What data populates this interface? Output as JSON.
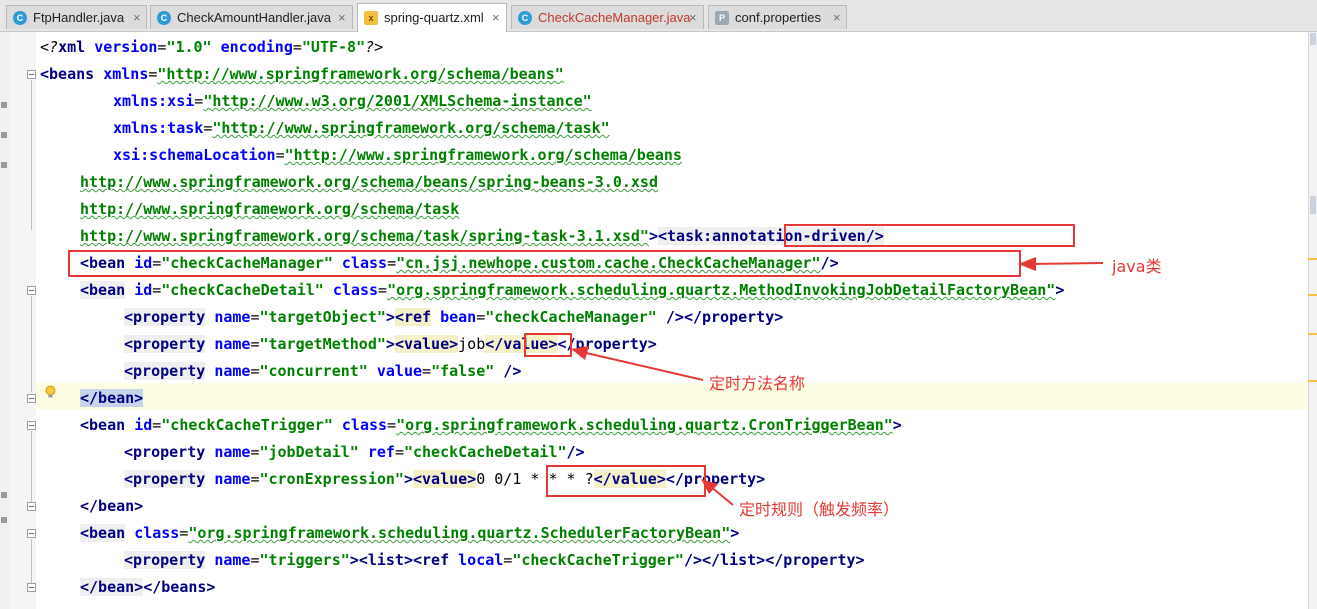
{
  "tabs": [
    {
      "label": "FtpHandler.java",
      "icon": "java-class-icon",
      "active": false
    },
    {
      "label": "CheckAmountHandler.java",
      "icon": "java-class-icon",
      "active": false
    },
    {
      "label": "spring-quartz.xml",
      "icon": "xml-file-icon",
      "active": true
    },
    {
      "label": "CheckCacheManager.java",
      "icon": "java-class-icon",
      "active": false,
      "color": "#c0392b"
    },
    {
      "label": "conf.properties",
      "icon": "properties-file-icon",
      "active": false
    }
  ],
  "close_glyph": "×",
  "editor": {
    "xml_decl": {
      "open": "<?",
      "name": "xml",
      "attr1": "version",
      "val1": "\"1.0\"",
      "attr2": "encoding",
      "val2": "\"UTF-8\"",
      "close": "?>"
    },
    "beans_open": {
      "tag": "<beans",
      "attr": "xmlns",
      "val": "\"http://www.springframework.org/schema/beans\""
    },
    "xmlns_xsi": {
      "attr": "xmlns:xsi",
      "val": "\"http://www.w3.org/2001/XMLSchema-instance\""
    },
    "xmlns_task": {
      "attr": "xmlns:task",
      "val": "\"http://www.springframework.org/schema/task\""
    },
    "schema_location": {
      "attr": "xsi:schemaLocation",
      "val_start": "\"http://www.springframework.org/schema/beans"
    },
    "schema_line2": "http://www.springframework.org/schema/beans/spring-beans-3.0.xsd",
    "schema_line3": "http://www.springframework.org/schema/task",
    "schema_line4": {
      "val_end": "http://www.springframework.org/schema/task/spring-task-3.1.xsd\"",
      "gt": ">",
      "task_tag": "<task:annotation-driven/>"
    },
    "bean_cache_manager": {
      "tag": "<bean",
      "attr_id": "id",
      "id": "\"checkCacheManager\"",
      "attr_class": "class",
      "class": "\"cn.jsj.newhope.custom.cache.CheckCacheManager\"",
      "close": "/>"
    },
    "bean_cache_detail": {
      "tag": "<bean",
      "attr_id": "id",
      "id": "\"checkCacheDetail\"",
      "attr_class": "class",
      "class": "\"org.springframework.scheduling.quartz.MethodInvokingJobDetailFactoryBean\"",
      "close": ">"
    },
    "prop_target_object": {
      "tag": "<property",
      "attr": "name",
      "name": "\"targetObject\"",
      "gt": ">",
      "ref_tag": "<ref",
      "ref_attr": "bean",
      "ref_val": "\"checkCacheManager\"",
      "ref_close": " />",
      "end": "</property>"
    },
    "prop_target_method": {
      "tag": "<property",
      "attr": "name",
      "name": "\"targetMethod\"",
      "gt": ">",
      "value_open": "<value>",
      "value": "job",
      "value_close": "</value>",
      "end": "</property>"
    },
    "prop_concurrent": {
      "tag": "<property",
      "attr": "name",
      "name": "\"concurrent\"",
      "attr2": "value",
      "val2": "\"false\"",
      "close": " />"
    },
    "bean_end_1": "</bean>",
    "bean_cache_trigger": {
      "tag": "<bean",
      "attr_id": "id",
      "id": "\"checkCacheTrigger\"",
      "attr_class": "class",
      "class": "\"org.springframework.scheduling.quartz.CronTriggerBean\"",
      "close": ">"
    },
    "prop_job_detail": {
      "tag": "<property",
      "attr": "name",
      "name": "\"jobDetail\"",
      "attr2": "ref",
      "val2": "\"checkCacheDetail\"",
      "close": "/>"
    },
    "prop_cron": {
      "tag": "<property",
      "attr": "name",
      "name": "\"cronExpression\"",
      "gt": ">",
      "value_open": "<value>",
      "value": "0 0/1 * * * ?",
      "value_close": "</value>",
      "end": "</property>"
    },
    "bean_end_2": "</bean>",
    "bean_scheduler": {
      "tag": "<bean",
      "attr_class": "class",
      "class": "\"org.springframework.scheduling.quartz.SchedulerFactoryBean\"",
      "close": ">"
    },
    "prop_triggers": {
      "tag": "<property",
      "attr": "name",
      "name": "\"triggers\"",
      "gt": ">",
      "list_open": "<list>",
      "ref_tag": "<ref",
      "ref_attr": "local",
      "ref_val": "\"checkCacheTrigger\"",
      "ref_close": "/>",
      "list_close": "</list>",
      "end": "</property>"
    },
    "final_line": {
      "bean_end": "</bean>",
      "beans_end": "</beans>"
    }
  },
  "annotations": {
    "java_class": "java类",
    "method_name": "定时方法名称",
    "cron_rule": "定时规则（触发频率）"
  },
  "colors": {
    "tag": "#000080",
    "attr": "#0000ff",
    "value": "#008000",
    "annotation_red": "#e53935"
  }
}
